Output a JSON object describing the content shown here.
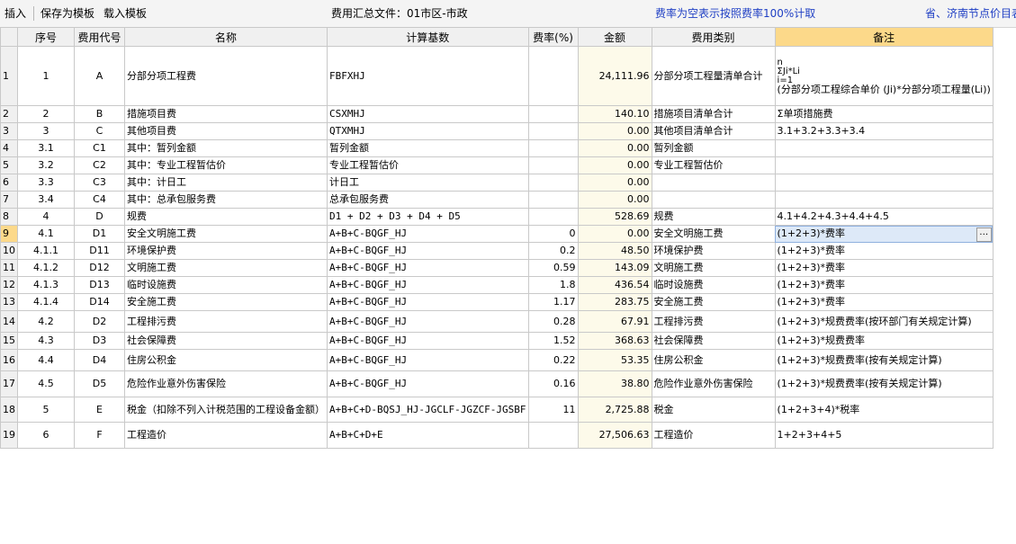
{
  "toolbar": {
    "insert": "插入",
    "save_template": "保存为模板",
    "load_template": "载入模板",
    "file_label": "费用汇总文件：01市区-市政",
    "note": "费率为空表示按照费率100%计取",
    "right_text": "省、济南节点价目表"
  },
  "table": {
    "headers": [
      "序号",
      "费用代号",
      "名称",
      "计算基数",
      "费率(%)",
      "金额",
      "费用类别",
      "备注"
    ],
    "rows": [
      {
        "n": "1",
        "seq": "1",
        "code": "A",
        "name": "分部分项工程费",
        "base": "FBFXHJ",
        "rate": "",
        "amount": "24,111.96",
        "cat": "分部分项工程量清单合计",
        "remark": "(分部分项工程综合单价 (Ji)*分部分项工程量(Li))"
      },
      {
        "n": "2",
        "seq": "2",
        "code": "B",
        "name": "措施项目费",
        "base": "CSXMHJ",
        "rate": "",
        "amount": "140.10",
        "cat": "措施项目清单合计",
        "remark": "Σ单项措施费"
      },
      {
        "n": "3",
        "seq": "3",
        "code": "C",
        "name": "其他项目费",
        "base": "QTXMHJ",
        "rate": "",
        "amount": "0.00",
        "cat": "其他项目清单合计",
        "remark": "3.1+3.2+3.3+3.4"
      },
      {
        "n": "4",
        "seq": "3.1",
        "code": "C1",
        "name": "其中：暂列金额",
        "base": "暂列金额",
        "rate": "",
        "amount": "0.00",
        "cat": "暂列金额",
        "remark": ""
      },
      {
        "n": "5",
        "seq": "3.2",
        "code": "C2",
        "name": "其中：专业工程暂估价",
        "base": "专业工程暂估价",
        "rate": "",
        "amount": "0.00",
        "cat": "专业工程暂估价",
        "remark": ""
      },
      {
        "n": "6",
        "seq": "3.3",
        "code": "C3",
        "name": "其中：计日工",
        "base": "计日工",
        "rate": "",
        "amount": "0.00",
        "cat": "",
        "remark": ""
      },
      {
        "n": "7",
        "seq": "3.4",
        "code": "C4",
        "name": "其中：总承包服务费",
        "base": "总承包服务费",
        "rate": "",
        "amount": "0.00",
        "cat": "",
        "remark": ""
      },
      {
        "n": "8",
        "seq": "4",
        "code": "D",
        "name": "规费",
        "base": "D1 + D2 + D3 + D4 + D5",
        "rate": "",
        "amount": "528.69",
        "cat": "规费",
        "remark": "4.1+4.2+4.3+4.4+4.5"
      },
      {
        "n": "9",
        "seq": "4.1",
        "code": "D1",
        "name": "安全文明施工费",
        "base": "A+B+C-BQGF_HJ",
        "rate": "0",
        "amount": "0.00",
        "cat": "安全文明施工费",
        "remark": "(1+2+3)*费率"
      },
      {
        "n": "10",
        "seq": "4.1.1",
        "code": "D11",
        "name": "环境保护费",
        "base": "A+B+C-BQGF_HJ",
        "rate": "0.2",
        "amount": "48.50",
        "cat": "环境保护费",
        "remark": "(1+2+3)*费率"
      },
      {
        "n": "11",
        "seq": "4.1.2",
        "code": "D12",
        "name": "文明施工费",
        "base": "A+B+C-BQGF_HJ",
        "rate": "0.59",
        "amount": "143.09",
        "cat": "文明施工费",
        "remark": "(1+2+3)*费率"
      },
      {
        "n": "12",
        "seq": "4.1.3",
        "code": "D13",
        "name": "临时设施费",
        "base": "A+B+C-BQGF_HJ",
        "rate": "1.8",
        "amount": "436.54",
        "cat": "临时设施费",
        "remark": "(1+2+3)*费率"
      },
      {
        "n": "13",
        "seq": "4.1.4",
        "code": "D14",
        "name": "安全施工费",
        "base": "A+B+C-BQGF_HJ",
        "rate": "1.17",
        "amount": "283.75",
        "cat": "安全施工费",
        "remark": "(1+2+3)*费率"
      },
      {
        "n": "14",
        "seq": "4.2",
        "code": "D2",
        "name": "工程排污费",
        "base": "A+B+C-BQGF_HJ",
        "rate": "0.28",
        "amount": "67.91",
        "cat": "工程排污费",
        "remark": "(1+2+3)*规费费率(按环部门有关规定计算)"
      },
      {
        "n": "15",
        "seq": "4.3",
        "code": "D3",
        "name": "社会保障费",
        "base": "A+B+C-BQGF_HJ",
        "rate": "1.52",
        "amount": "368.63",
        "cat": "社会保障费",
        "remark": "(1+2+3)*规费费率"
      },
      {
        "n": "16",
        "seq": "4.4",
        "code": "D4",
        "name": "住房公积金",
        "base": "A+B+C-BQGF_HJ",
        "rate": "0.22",
        "amount": "53.35",
        "cat": "住房公积金",
        "remark": "(1+2+3)*规费费率(按有关规定计算)"
      },
      {
        "n": "17",
        "seq": "4.5",
        "code": "D5",
        "name": "危险作业意外伤害保险",
        "base": "A+B+C-BQGF_HJ",
        "rate": "0.16",
        "amount": "38.80",
        "cat": "危险作业意外伤害保险",
        "remark": "(1+2+3)*规费费率(按有关规定计算)"
      },
      {
        "n": "18",
        "seq": "5",
        "code": "E",
        "name": "税金（扣除不列入计税范围的工程设备金额）",
        "base": "A+B+C+D-BQSJ_HJ-JGCLF-JGZCF-JGSBF",
        "rate": "11",
        "amount": "2,725.88",
        "cat": "税金",
        "remark": "(1+2+3+4)*税率"
      },
      {
        "n": "19",
        "seq": "6",
        "code": "F",
        "name": "工程造价",
        "base": "A+B+C+D+E",
        "rate": "",
        "amount": "27,506.63",
        "cat": "工程造价",
        "remark": "1+2+3+4+5"
      }
    ],
    "sigma": {
      "top": "n",
      "mid": "ΣJi*Li",
      "bot": "i=1"
    },
    "ellipsis": "…"
  }
}
